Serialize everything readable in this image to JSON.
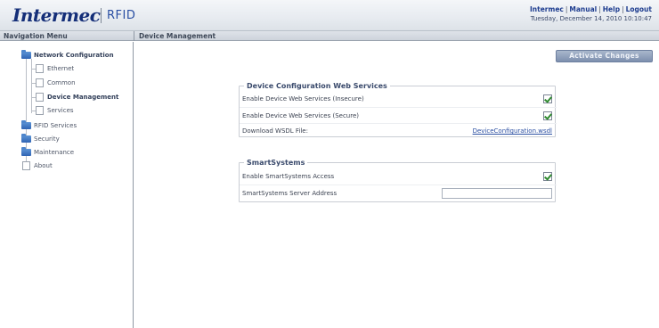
{
  "header": {
    "brand": "Intermec",
    "product": "RFID",
    "links": [
      "Intermec",
      "Manual",
      "Help",
      "Logout"
    ],
    "date": "Tuesday, December 14, 2010 10:10:47"
  },
  "titlebar": {
    "nav_title": "Navigation Menu",
    "page_title": "Device Management"
  },
  "nav": {
    "network_configuration": "Network Configuration",
    "ethernet": "Ethernet",
    "common": "Common",
    "device_management": "Device Management",
    "services": "Services",
    "rfid_services": "RFID Services",
    "security": "Security",
    "maintenance": "Maintenance",
    "about": "About"
  },
  "main": {
    "activate_label": "Activate Changes",
    "web_services": {
      "title": "Device Configuration Web Services",
      "insecure_label": "Enable Device Web Services (Insecure)",
      "insecure_checked": true,
      "secure_label": "Enable Device Web Services (Secure)",
      "secure_checked": true,
      "wsdl_label": "Download WSDL File:",
      "wsdl_link": "DeviceConfiguration.wsdl"
    },
    "smartsystems": {
      "title": "SmartSystems",
      "access_label": "Enable SmartSystems Access",
      "access_checked": true,
      "server_label": "SmartSystems Server Address",
      "server_value": ""
    }
  },
  "colors": {
    "brand": "#142e78",
    "link": "#2b4fa2",
    "folder": "#2f64b4",
    "button": "#7d8fae"
  }
}
